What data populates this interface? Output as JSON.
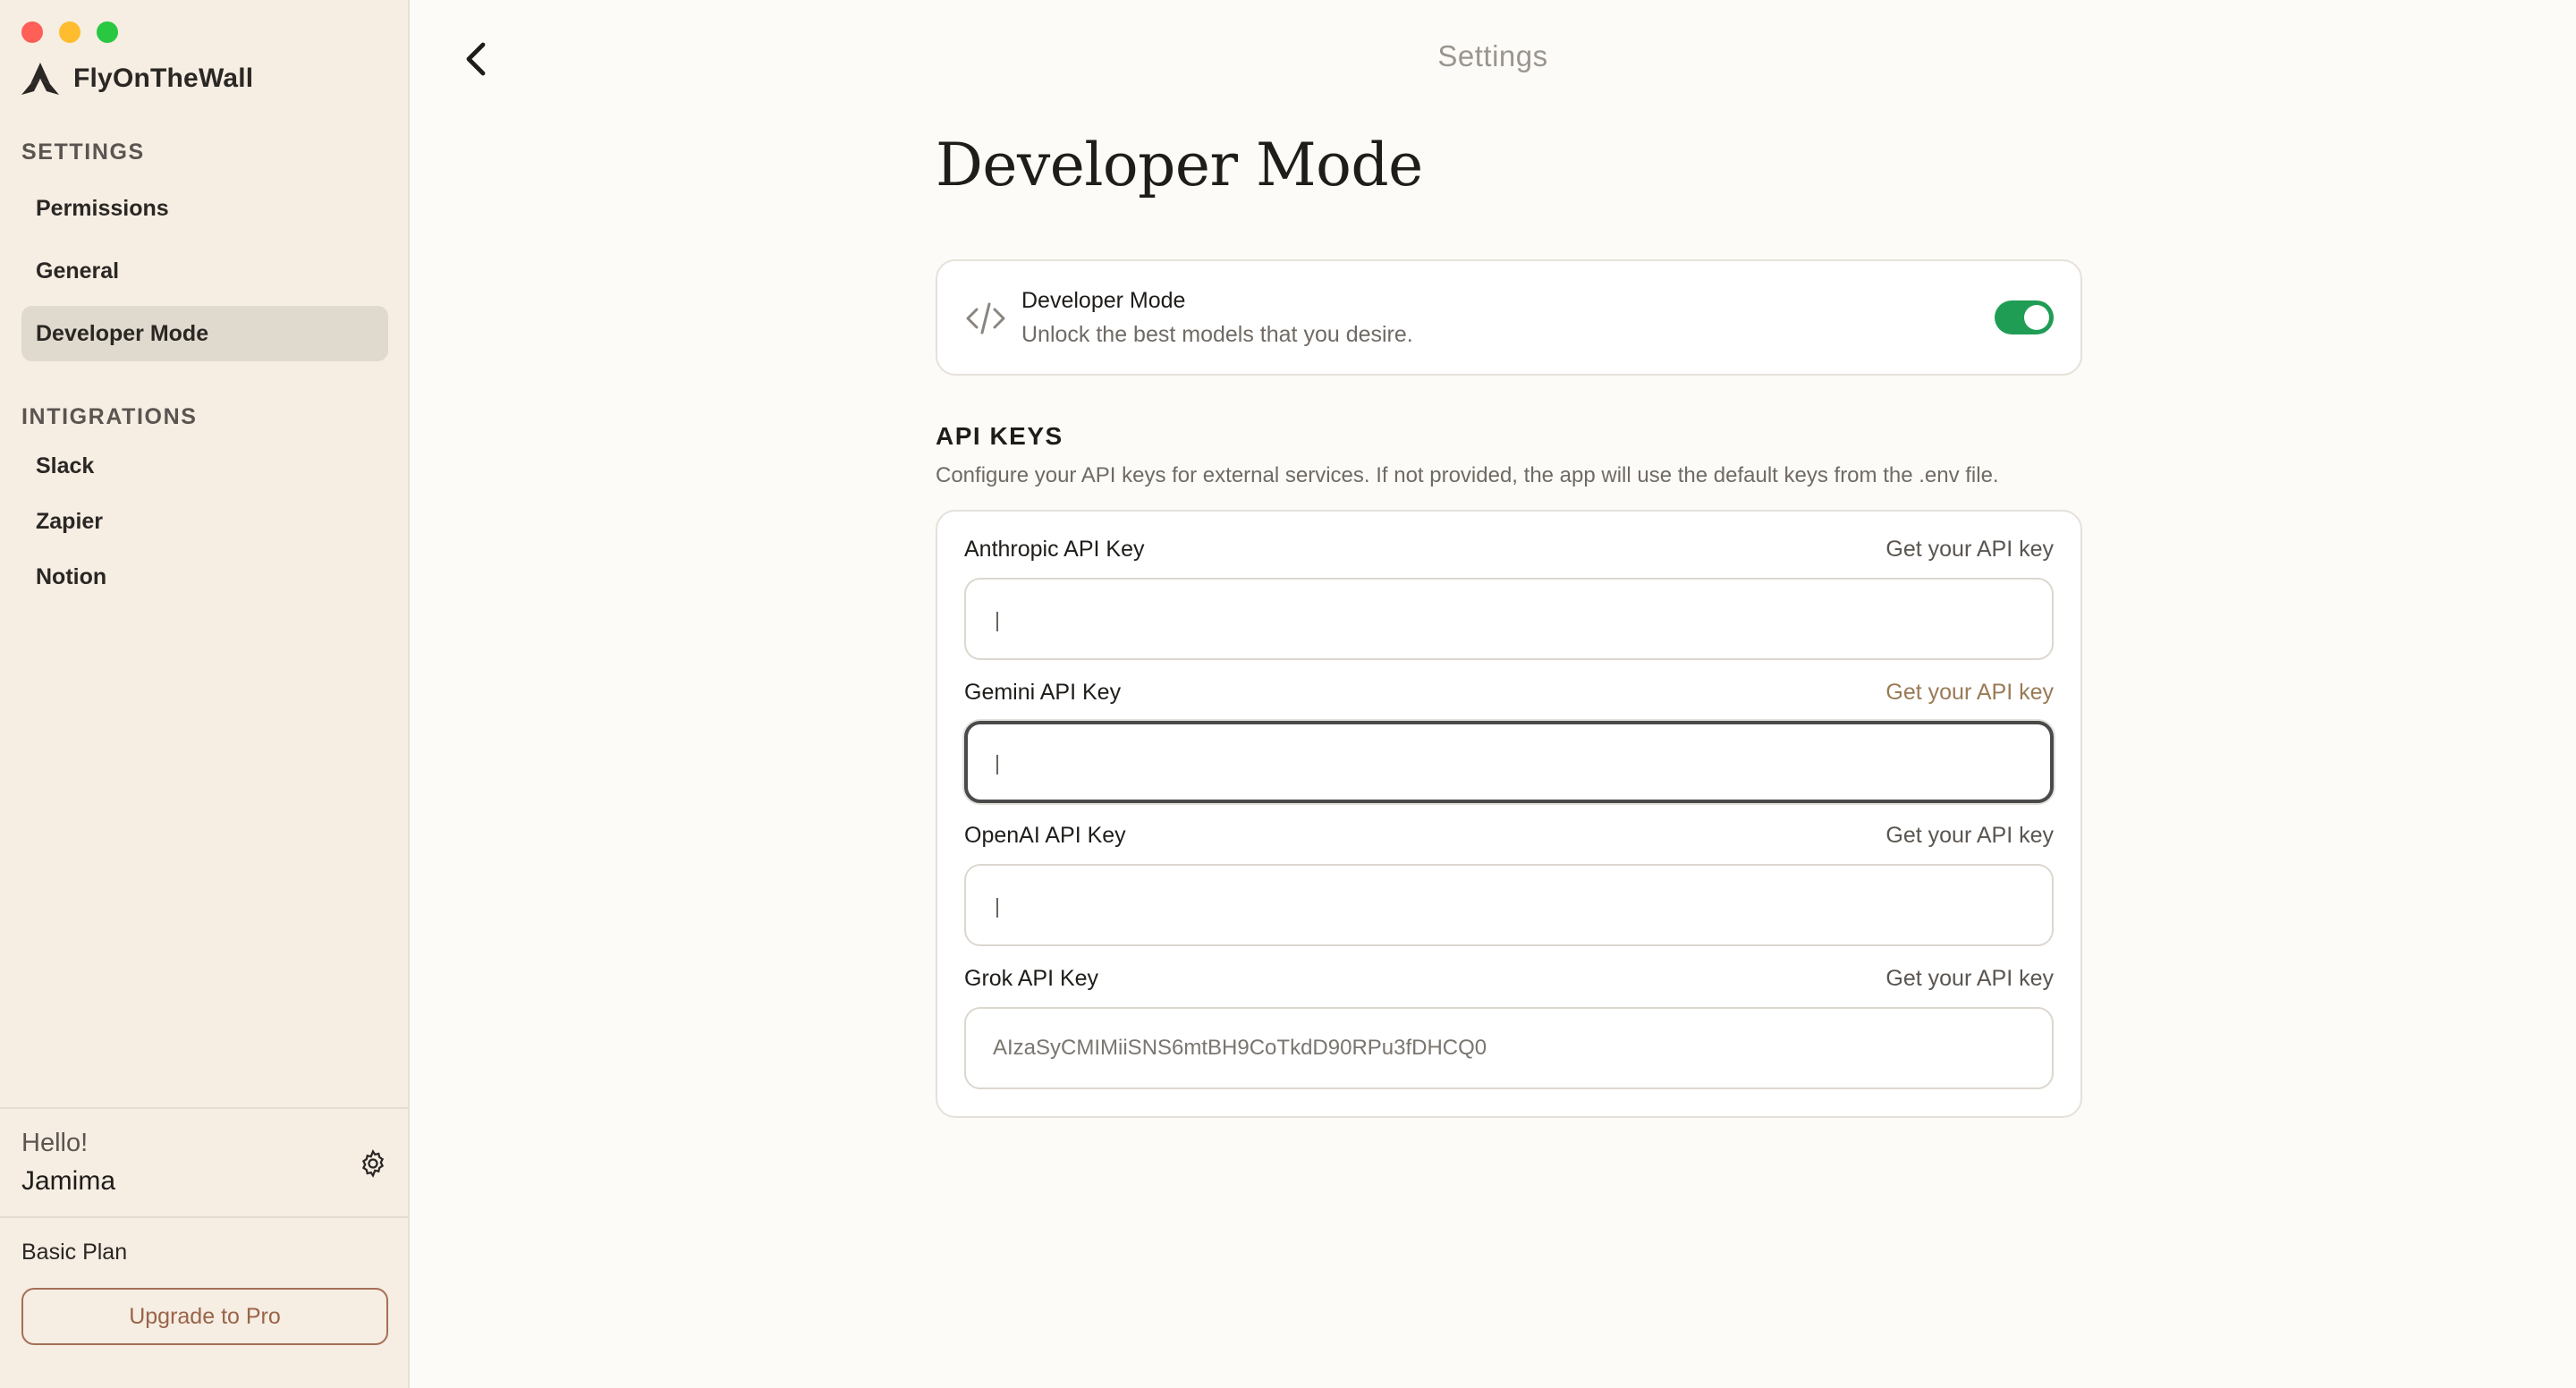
{
  "app": {
    "name": "FlyOnTheWall"
  },
  "sidebar": {
    "settings_label": "SETTINGS",
    "settings_items": [
      {
        "label": "Permissions",
        "active": false
      },
      {
        "label": "General",
        "active": false
      },
      {
        "label": "Developer Mode",
        "active": true
      }
    ],
    "integrations_label": "INTIGRATIONS",
    "integration_items": [
      {
        "label": "Slack"
      },
      {
        "label": "Zapier"
      },
      {
        "label": "Notion"
      }
    ],
    "user": {
      "greeting": "Hello!",
      "name": "Jamima"
    },
    "plan": "Basic Plan",
    "upgrade_label": "Upgrade to Pro"
  },
  "header": {
    "title": "Settings"
  },
  "main": {
    "page_title": "Developer Mode",
    "developer_mode": {
      "title": "Developer Mode",
      "subtitle": "Unlock the best models that you desire.",
      "enabled": true
    },
    "api_keys": {
      "heading": "API KEYS",
      "description": "Configure your API keys for external services. If not provided, the app will use the default keys from the .env file.",
      "keys": [
        {
          "label": "Anthropic API Key",
          "link": "Get your API key",
          "value": ""
        },
        {
          "label": "Gemini API Key",
          "link": "Get your API key",
          "value": ""
        },
        {
          "label": "OpenAI API Key",
          "link": "Get your API key",
          "value": ""
        },
        {
          "label": "Grok API Key",
          "link": "Get your API key",
          "value": "AIzaSyCMIMiiSNS6mtBH9CoTkdD90RPu3fDHCQ0"
        }
      ]
    }
  },
  "colors": {
    "sidebar_bg": "#f6ede3",
    "active_item_bg": "#e0d9cd",
    "toggle_on": "#1f9d55",
    "upgrade_accent": "#9a6449",
    "traffic_close": "#fe5f57",
    "traffic_min": "#febc2e",
    "traffic_max": "#28c840"
  },
  "icons": {
    "brand": "fly-logo-icon",
    "settings": "gear-icon",
    "back": "chevron-left-icon",
    "developer": "code-icon"
  }
}
